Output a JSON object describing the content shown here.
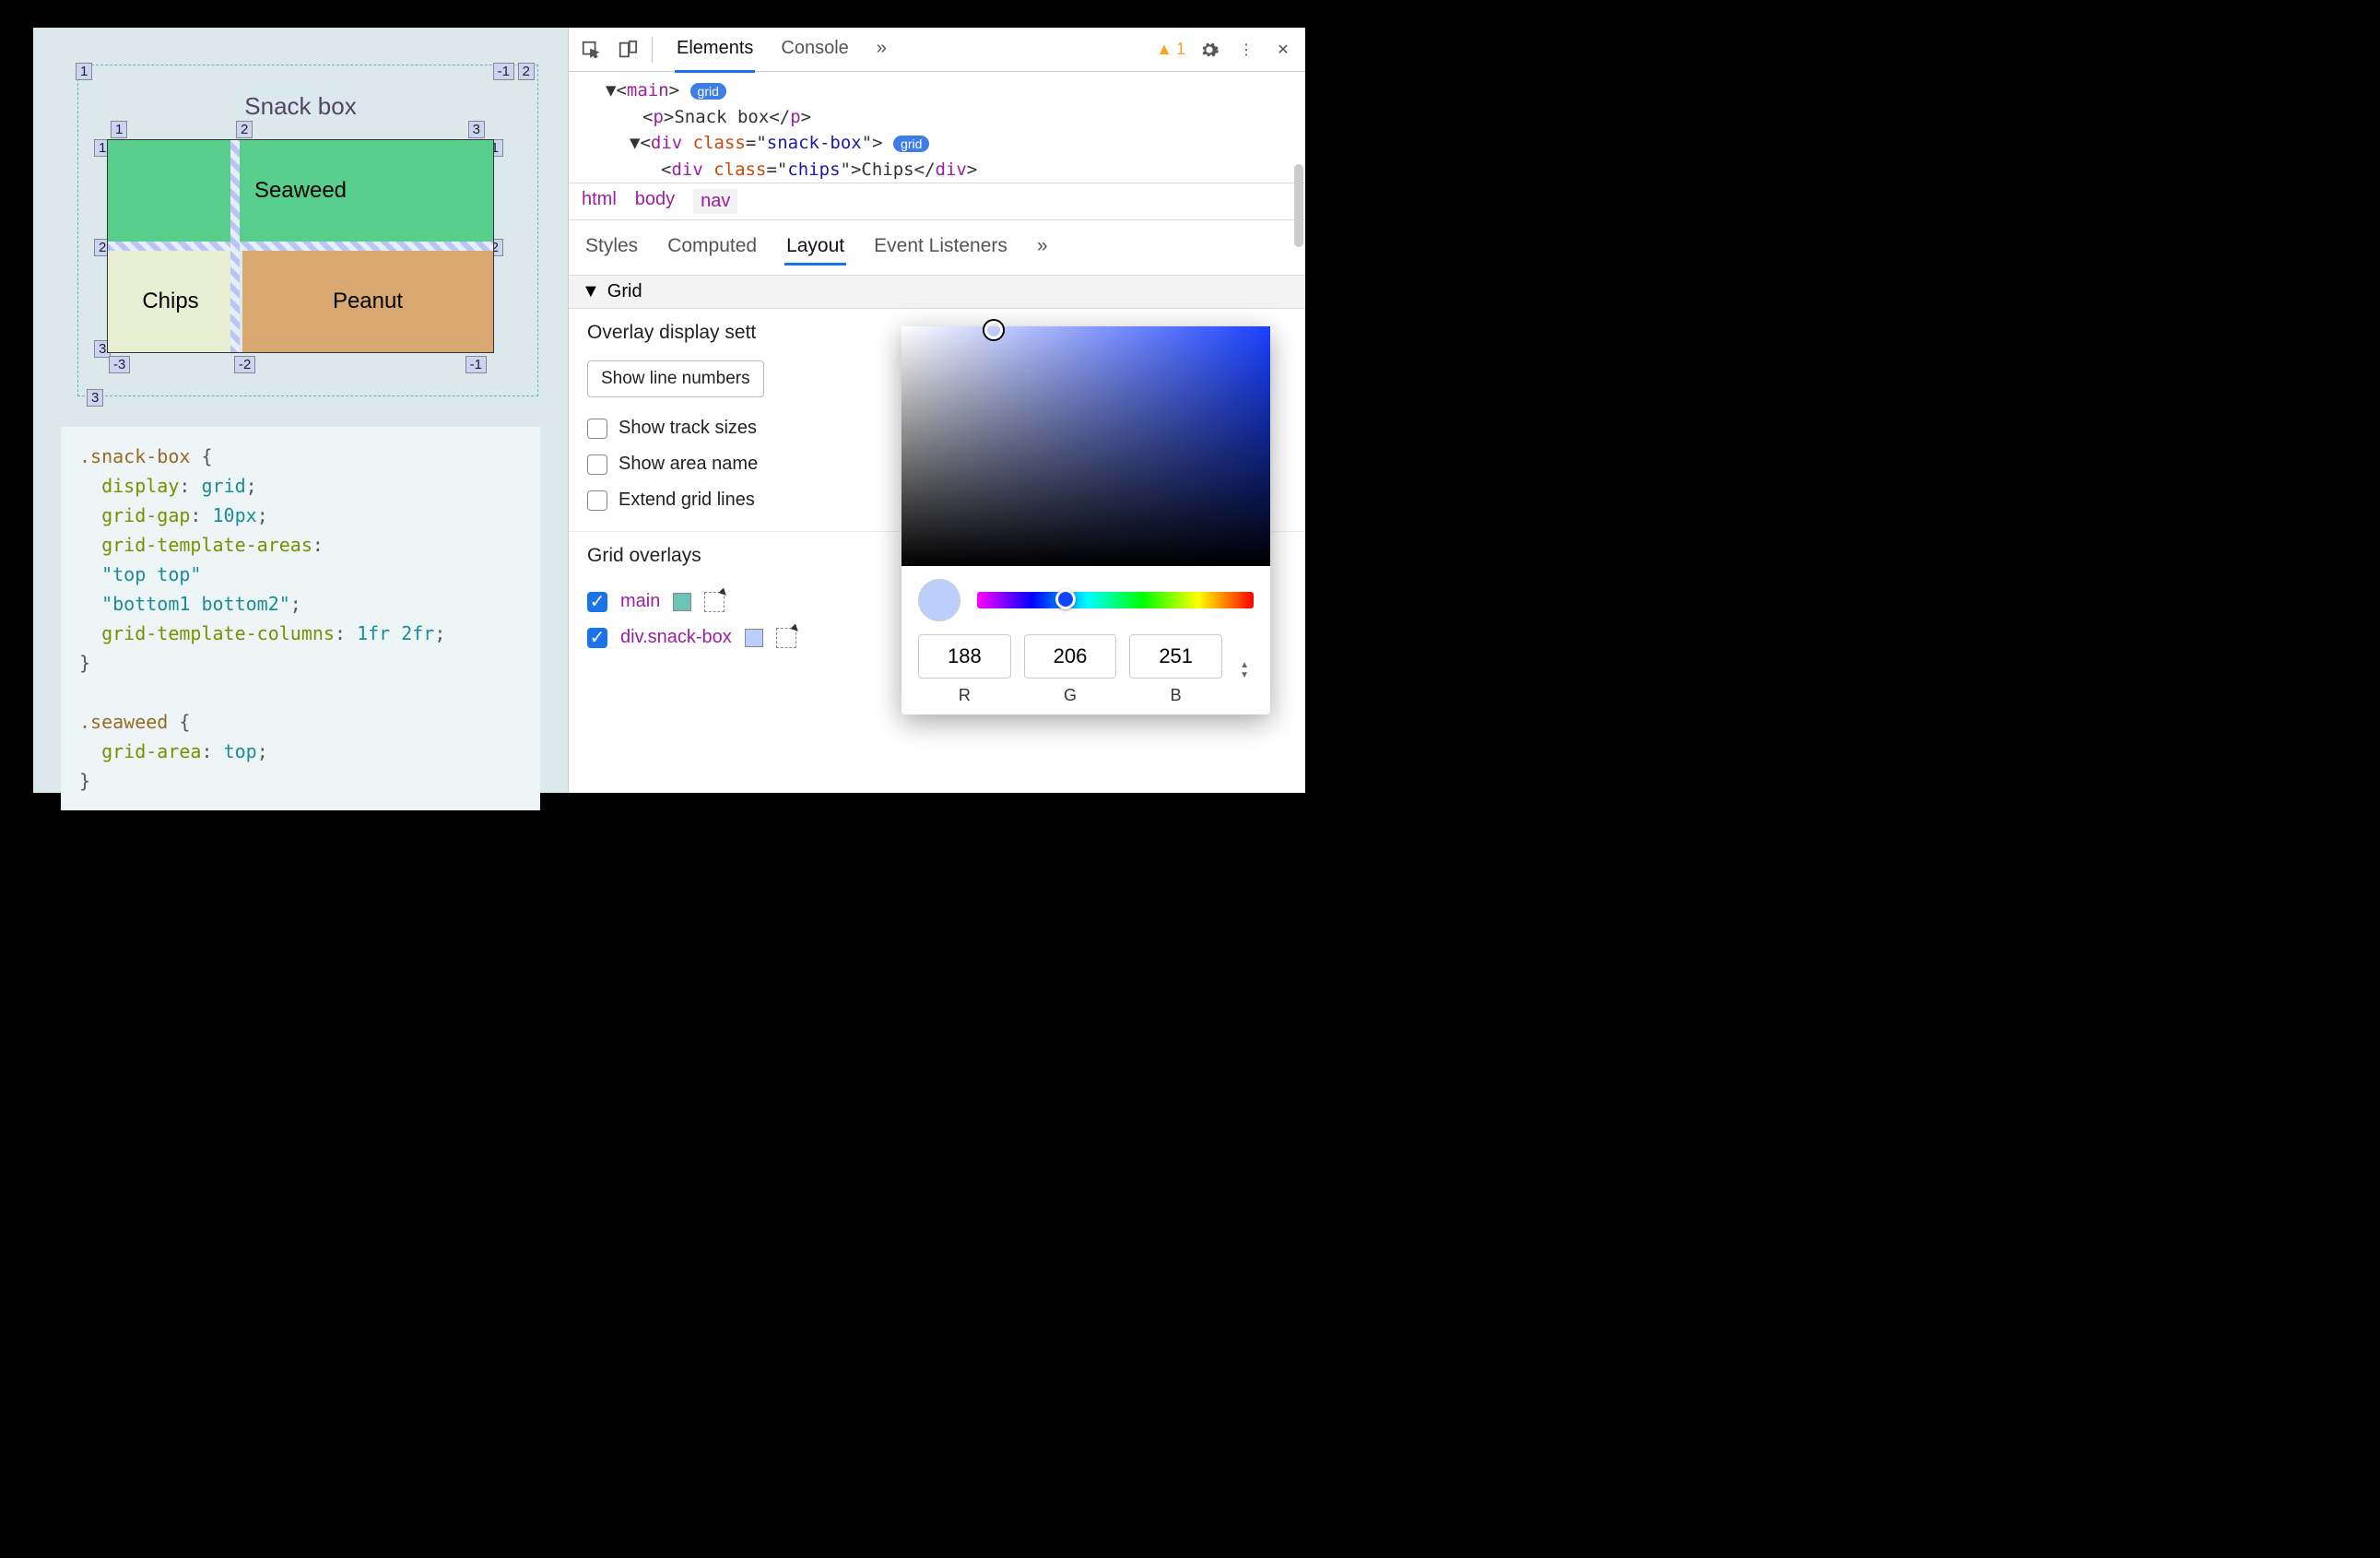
{
  "page": {
    "title": "Snack box",
    "gridItems": {
      "seaweed": "Seaweed",
      "chips": "Chips",
      "peanut": "Peanut"
    },
    "outerLabels": {
      "tl": "1",
      "tr": "2",
      "bl": "3",
      "trNegR": "-1"
    },
    "innerLabels": {
      "c1": "1",
      "c2": "2",
      "c3": "3",
      "r1l": "1",
      "r2l": "2",
      "r3l": "3",
      "r1r": "-1",
      "r2r": "-2",
      "c1b": "-3",
      "c2b": "-2",
      "c3b": "-1"
    },
    "css": ".snack-box {\n  display: grid;\n  grid-gap: 10px;\n  grid-template-areas:\n  \"top top\"\n  \"bottom1 bottom2\";\n  grid-template-columns: 1fr 2fr;\n}\n\n.seaweed {\n  grid-area: top;\n}"
  },
  "toolbar": {
    "tabs": {
      "elements": "Elements",
      "console": "Console"
    },
    "warningsCount": "1"
  },
  "dom": {
    "mainTag": "main",
    "gridBadge": "grid",
    "pLine": "Snack box",
    "divClass": "snack-box",
    "chipsClass": "chips",
    "chipsText": "Chips"
  },
  "breadcrumbs": [
    "html",
    "body",
    "nav"
  ],
  "subTabs": {
    "styles": "Styles",
    "computed": "Computed",
    "layout": "Layout",
    "events": "Event Listeners"
  },
  "grid": {
    "section": "Grid",
    "overlayHeading": "Overlay display sett",
    "select": "Show line numbers",
    "opts": {
      "trackSizes": "Show track sizes",
      "areaNames": "Show area name",
      "extend": "Extend grid lines"
    },
    "overlaysHeading": "Grid overlays",
    "overlays": [
      {
        "label": "main",
        "checked": true,
        "color": "#6bc4b6"
      },
      {
        "label": "div.snack-box",
        "checked": true,
        "color": "#bccefb"
      }
    ]
  },
  "picker": {
    "r": "188",
    "g": "206",
    "b": "251",
    "labels": {
      "r": "R",
      "g": "G",
      "b": "B"
    }
  }
}
